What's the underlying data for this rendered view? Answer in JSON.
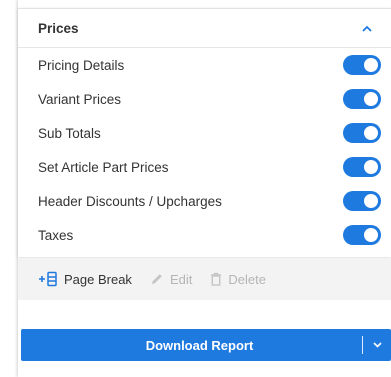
{
  "prices": {
    "title": "Prices",
    "items": [
      {
        "label": "Pricing Details",
        "enabled": true
      },
      {
        "label": "Variant Prices",
        "enabled": true
      },
      {
        "label": "Sub Totals",
        "enabled": true
      },
      {
        "label": "Set Article Part Prices",
        "enabled": true
      },
      {
        "label": "Header Discounts / Upcharges",
        "enabled": true
      },
      {
        "label": "Taxes",
        "enabled": true
      }
    ]
  },
  "toolbar": {
    "page_break_label": "Page Break",
    "edit_label": "Edit",
    "delete_label": "Delete",
    "page_break_icon": "add-page-break-icon",
    "edit_icon": "pencil-icon",
    "delete_icon": "trash-icon"
  },
  "download": {
    "label": "Download Report",
    "dropdown_icon": "chevron-down-icon"
  },
  "colors": {
    "accent": "#1f7ae0",
    "toolbar_bg": "#f3f3f3",
    "disabled_text": "#b5b5b5"
  }
}
